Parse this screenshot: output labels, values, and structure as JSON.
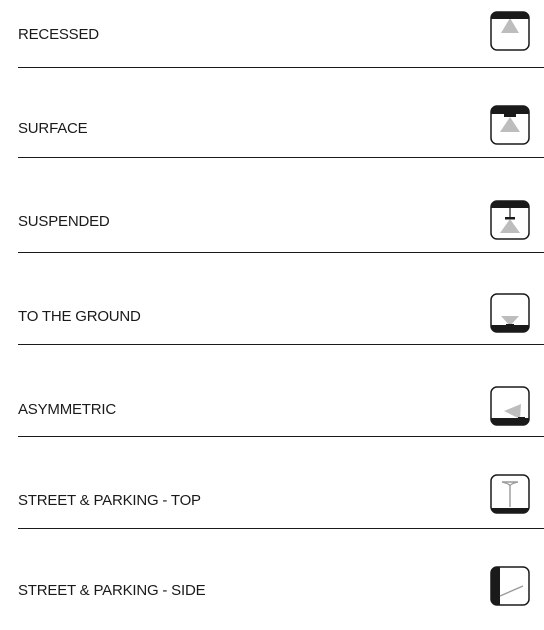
{
  "categories": [
    {
      "label": "RECESSED",
      "icon": "recessed-fixture-icon"
    },
    {
      "label": "SURFACE",
      "icon": "surface-fixture-icon"
    },
    {
      "label": "SUSPENDED",
      "icon": "suspended-fixture-icon"
    },
    {
      "label": "TO THE GROUND",
      "icon": "downlight-ground-icon"
    },
    {
      "label": "ASYMMETRIC",
      "icon": "asymmetric-fixture-icon"
    },
    {
      "label": "STREET & PARKING - TOP",
      "icon": "street-parking-top-icon"
    },
    {
      "label": "STREET & PARKING - SIDE",
      "icon": "street-parking-side-icon"
    }
  ]
}
